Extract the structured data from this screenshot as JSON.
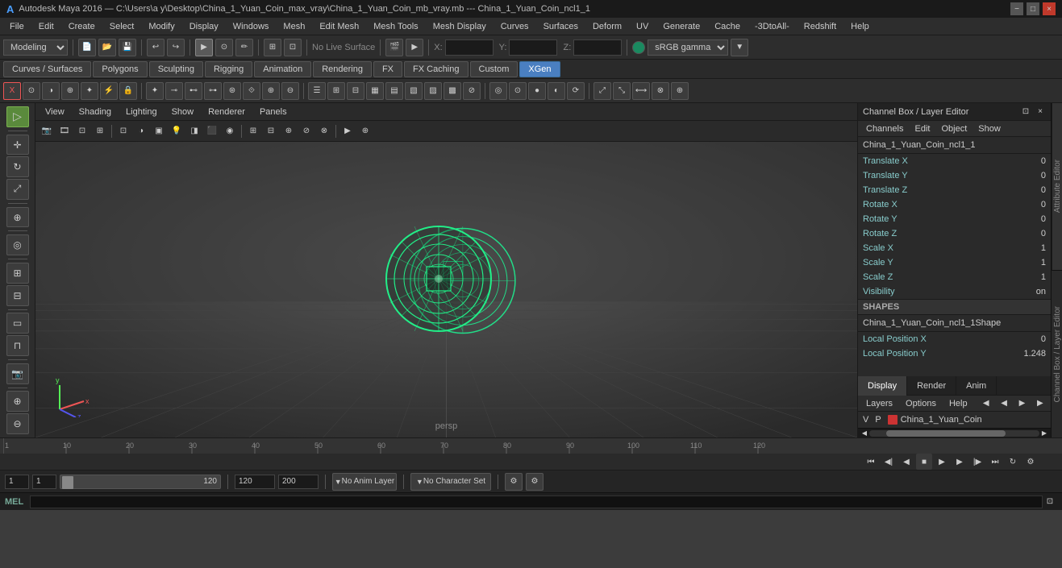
{
  "titlebar": {
    "logo": "A",
    "app": "Autodesk Maya 2016",
    "path": "C:\\Users\\a y\\Desktop\\China_1_Yuan_Coin_max_vray\\China_1_Yuan_Coin_mb_vray.mb",
    "divider": "---",
    "scene": "China_1_Yuan_Coin_ncl1_1"
  },
  "menu": {
    "items": [
      "File",
      "Edit",
      "Create",
      "Select",
      "Modify",
      "Display",
      "Windows",
      "Mesh",
      "Edit Mesh",
      "Mesh Tools",
      "Mesh Display",
      "Curves",
      "Surfaces",
      "Deform",
      "UV",
      "Generate",
      "Cache",
      "-3DtoAll-",
      "Redshift",
      "Help"
    ]
  },
  "toolbar1": {
    "mode_dropdown": "Modeling",
    "live_surface": "No Live Surface",
    "x_label": "X:",
    "y_label": "Y:",
    "z_label": "Z:",
    "color_space": "sRGB gamma"
  },
  "module_tabs": {
    "tabs": [
      "Curves / Surfaces",
      "Polygons",
      "Sculpting",
      "Rigging",
      "Animation",
      "Rendering",
      "FX",
      "FX Caching",
      "Custom",
      "XGen"
    ]
  },
  "viewport": {
    "menu_items": [
      "View",
      "Shading",
      "Lighting",
      "Show",
      "Renderer",
      "Panels"
    ],
    "label": "persp"
  },
  "channel_box": {
    "title": "Channel Box / Layer Editor",
    "menus": [
      "Channels",
      "Edit",
      "Object",
      "Show"
    ],
    "selected_object": "China_1_Yuan_Coin_ncl1_1",
    "channels": [
      {
        "name": "Translate X",
        "value": "0"
      },
      {
        "name": "Translate Y",
        "value": "0"
      },
      {
        "name": "Translate Z",
        "value": "0"
      },
      {
        "name": "Rotate X",
        "value": "0"
      },
      {
        "name": "Rotate Y",
        "value": "0"
      },
      {
        "name": "Rotate Z",
        "value": "0"
      },
      {
        "name": "Scale X",
        "value": "1"
      },
      {
        "name": "Scale Y",
        "value": "1"
      },
      {
        "name": "Scale Z",
        "value": "1"
      },
      {
        "name": "Visibility",
        "value": "on"
      }
    ],
    "shapes_label": "SHAPES",
    "shapes_object": "China_1_Yuan_Coin_ncl1_1Shape",
    "shape_channels": [
      {
        "name": "Local Position X",
        "value": "0"
      },
      {
        "name": "Local Position Y",
        "value": "1.248"
      }
    ],
    "tabs": [
      "Display",
      "Render",
      "Anim"
    ],
    "layers_menus": [
      "Layers",
      "Options",
      "Help"
    ],
    "layers": [
      {
        "name": "V",
        "p": "P",
        "color": "#cc3333",
        "label": "China_1_Yuan_Coin"
      }
    ]
  },
  "timeline": {
    "start": "1",
    "end": "120",
    "current": "1",
    "markers": [
      "1",
      "10",
      "20",
      "30",
      "40",
      "50",
      "60",
      "70",
      "80",
      "90",
      "100",
      "110",
      "120"
    ],
    "playback_end": "120",
    "anim_end": "200",
    "no_anim_layer": "No Anim Layer",
    "no_char_set": "No Character Set"
  },
  "bottom": {
    "frame1": "1",
    "frame2": "1",
    "frame3": "1",
    "frame_end": "120"
  },
  "mel": {
    "label": "MEL"
  },
  "icons": {
    "arrow": "▲",
    "move": "✛",
    "rotate": "↻",
    "scale": "⤢",
    "shear": "⬡",
    "snap": "⊕",
    "gear": "⚙",
    "play": "▶",
    "prev": "◀",
    "next": "▶",
    "first": "⏮",
    "last": "⏭",
    "minimize": "−",
    "maximize": "□",
    "close": "×"
  }
}
